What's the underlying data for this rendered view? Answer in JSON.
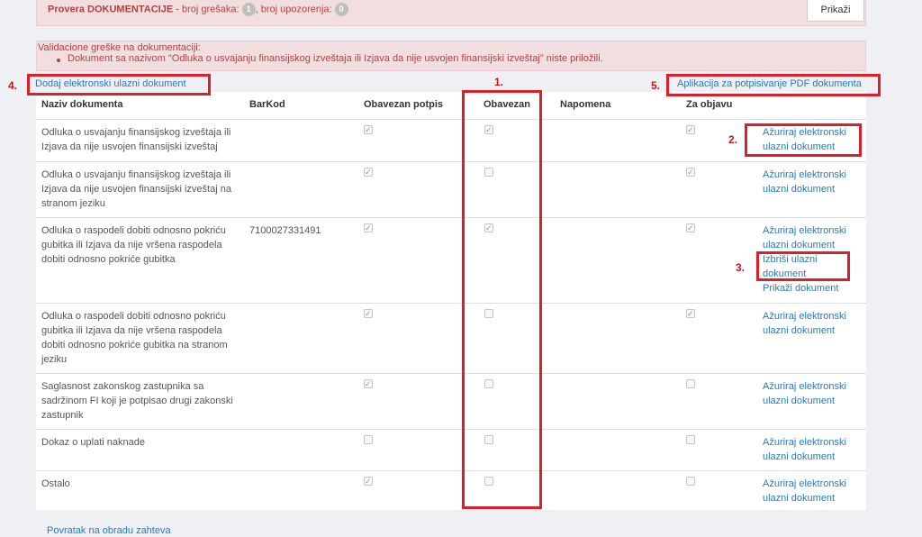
{
  "status": {
    "title": "Provera DOKUMENTACIJE",
    "errors_label": " - broj grešaka: ",
    "errors_count": "1",
    "warnings_label": ", broj upozorenja: ",
    "warnings_count": "0",
    "button_label": "Prikaži"
  },
  "validation": {
    "title": "Validacione greške na dokumentaciji:",
    "items": [
      "Dokument sa nazivom \"Odluka o usvajanju finansijskog izveštaja ili Izjava da nije usvojen finansijski izveštaj\" niste priložili."
    ]
  },
  "links": {
    "add_document": "Dodaj elektronski ulazni dokument",
    "pdf_app": "Aplikacija za potpisivanje PDF dokumenta",
    "back": "Povratak na obradu zahteva"
  },
  "table": {
    "headers": {
      "name": "Naziv dokumenta",
      "barcode": "BarKod",
      "signature": "Obavezan potpis",
      "mandatory": "Obavezan",
      "note": "Napomena",
      "publish": "Za objavu"
    },
    "rows": [
      {
        "name": "Odluka o usvajanju finansijskog izveštaja ili Izjava da nije usvojen finansijski izveštaj",
        "barcode": "",
        "signature": true,
        "mandatory": true,
        "publish": true,
        "actions": [
          "Ažuriraj elektronski ulazni dokument"
        ]
      },
      {
        "name": "Odluka o usvajanju finansijskog izveštaja ili Izjava da nije usvojen finansijski izveštaj na stranom jeziku",
        "barcode": "",
        "signature": true,
        "mandatory": false,
        "publish": true,
        "actions": [
          "Ažuriraj elektronski ulazni dokument"
        ]
      },
      {
        "name": "Odluka o raspodeli dobiti odnosno pokriću gubitka ili Izjava da nije vršena raspodela dobiti odnosno pokriće gubitka",
        "barcode": "7100027331491",
        "signature": true,
        "mandatory": true,
        "publish": true,
        "actions": [
          "Ažuriraj elektronski ulazni dokument",
          "Izbriši ulazni dokument",
          "Prikaži dokument"
        ]
      },
      {
        "name": "Odluka o raspodeli dobiti odnosno pokriću gubitka ili Izjava da nije vršena raspodela dobiti odnosno pokriće gubitka na stranom jeziku",
        "barcode": "",
        "signature": true,
        "mandatory": false,
        "publish": true,
        "actions": [
          "Ažuriraj elektronski ulazni dokument"
        ]
      },
      {
        "name": "Saglasnost zakonskog zastupnika sa sadržinom FI koji je potpisao drugi zakonski zastupnik",
        "barcode": "",
        "signature": true,
        "mandatory": false,
        "publish": false,
        "actions": [
          "Ažuriraj elektronski ulazni dokument"
        ]
      },
      {
        "name": "Dokaz o uplati naknade",
        "barcode": "",
        "signature": false,
        "mandatory": false,
        "publish": false,
        "actions": [
          "Ažuriraj elektronski ulazni dokument"
        ]
      },
      {
        "name": "Ostalo",
        "barcode": "",
        "signature": true,
        "mandatory": false,
        "publish": false,
        "actions": [
          "Ažuriraj elektronski ulazni dokument"
        ]
      }
    ]
  },
  "annotations": {
    "n1": "1.",
    "n2": "2.",
    "n3": "3.",
    "n4": "4.",
    "n5": "5.",
    "color": "#dd1f2a"
  }
}
